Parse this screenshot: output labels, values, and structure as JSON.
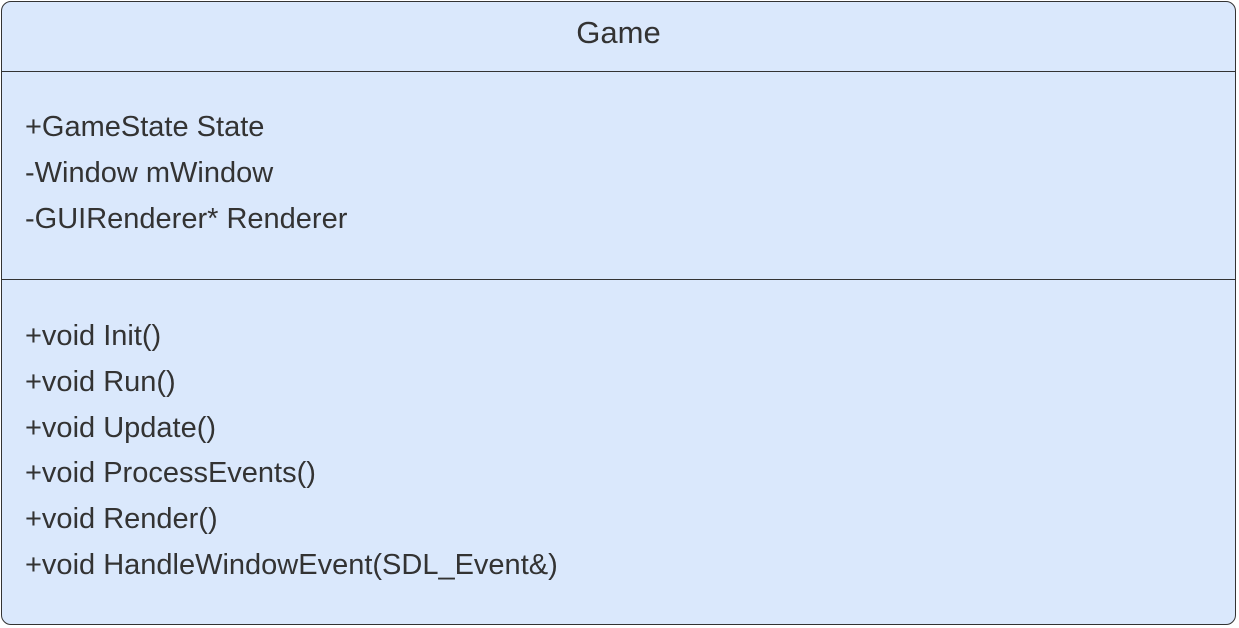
{
  "class": {
    "name": "Game",
    "attributes": [
      "+GameState State",
      "-Window mWindow",
      "-GUIRenderer* Renderer"
    ],
    "methods": [
      "+void Init()",
      "+void Run()",
      "+void Update()",
      "+void ProcessEvents()",
      "+void Render()",
      "+void HandleWindowEvent(SDL_Event&)"
    ]
  },
  "colors": {
    "fill": "#dae8fc",
    "stroke": "#333333",
    "text": "#333333"
  }
}
